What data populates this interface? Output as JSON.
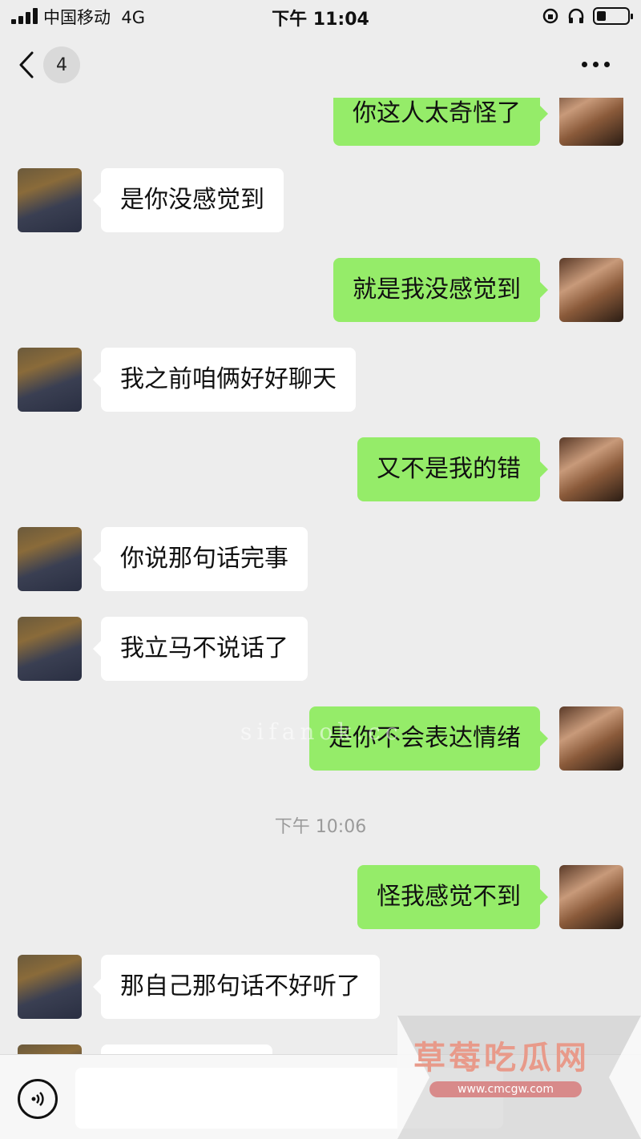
{
  "status_bar": {
    "carrier": "中国移动",
    "network": "4G",
    "time": "下午 11:04",
    "battery_level": 0.3
  },
  "nav": {
    "back_icon": "chevron-left-icon",
    "unread_count": "4",
    "more_icon": "more-dots-icon"
  },
  "messages": [
    {
      "sender": "self",
      "text": "你这人太奇怪了"
    },
    {
      "sender": "friend",
      "text": "是你没感觉到"
    },
    {
      "sender": "self",
      "text": "就是我没感觉到"
    },
    {
      "sender": "friend",
      "text": "我之前咱俩好好聊天"
    },
    {
      "sender": "self",
      "text": "又不是我的错"
    },
    {
      "sender": "friend",
      "text": "你说那句话完事"
    },
    {
      "sender": "friend",
      "text": "我立马不说话了"
    },
    {
      "sender": "self",
      "text": "是你不会表达情绪"
    },
    {
      "sender": "friend",
      "text": "那自己那句话不好听了"
    }
  ],
  "time_divider": "下午 10:06",
  "self_after_divider": "怪我感觉不到",
  "watermark": "sifanok.cc",
  "input": {
    "voice_icon": "voice-icon",
    "placeholder": ""
  },
  "promo": {
    "title": "草莓吃瓜网",
    "url": "www.cmcgw.com"
  },
  "colors": {
    "self_bubble": "#95ec69",
    "friend_bubble": "#ffffff",
    "background": "#ededed"
  }
}
